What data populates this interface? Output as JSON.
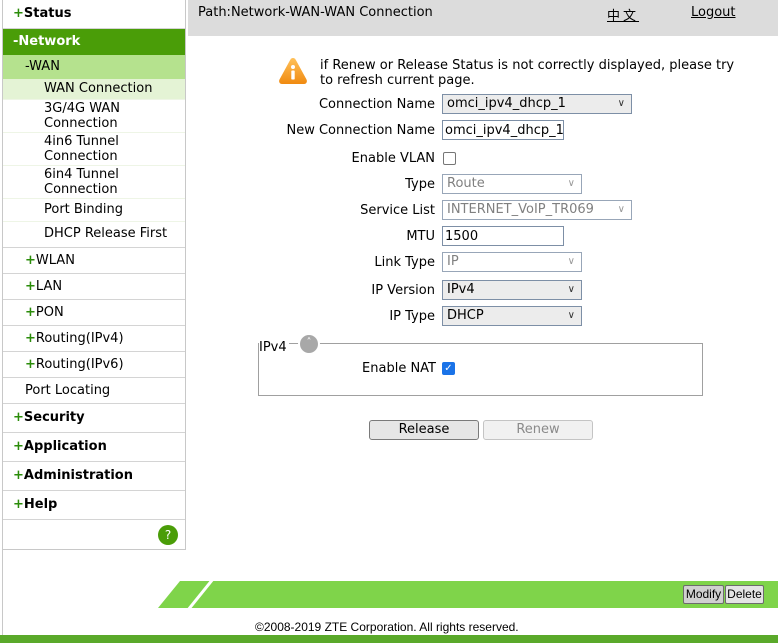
{
  "sidebar": {
    "status": "Status",
    "network": "-Network",
    "wan": "-WAN",
    "wan_items": [
      {
        "label": "WAN Connection"
      },
      {
        "label_line1": "3G/4G WAN",
        "label_line2": "Connection"
      },
      {
        "label_line1": "4in6 Tunnel",
        "label_line2": "Connection"
      },
      {
        "label_line1": "6in4 Tunnel",
        "label_line2": "Connection"
      },
      {
        "label": "Port Binding"
      },
      {
        "label": "DHCP Release First"
      }
    ],
    "network_items": [
      "WLAN",
      "LAN",
      "PON",
      "Routing(IPv4)",
      "Routing(IPv6)"
    ],
    "port_locating": "Port Locating",
    "bottom_items": [
      "Security",
      "Application",
      "Administration",
      "Help"
    ],
    "plus": "+",
    "help_icon": "?"
  },
  "header": {
    "path": "Path:Network-WAN-WAN Connection",
    "language": "中文",
    "logout": "Logout"
  },
  "notice": {
    "icon": "warning-icon",
    "text": "if Renew or Release Status is not correctly displayed, please try to refresh current page."
  },
  "form": {
    "connection_name": {
      "label": "Connection Name",
      "value": "omci_ipv4_dhcp_1"
    },
    "new_connection_name": {
      "label": "New Connection Name",
      "value": "omci_ipv4_dhcp_1"
    },
    "enable_vlan": {
      "label": "Enable VLAN",
      "checked": false
    },
    "type": {
      "label": "Type",
      "value": "Route"
    },
    "service_list": {
      "label": "Service List",
      "value": "INTERNET_VoIP_TR069"
    },
    "mtu": {
      "label": "MTU",
      "value": "1500"
    },
    "link_type": {
      "label": "Link Type",
      "value": "IP"
    },
    "ip_version": {
      "label": "IP Version",
      "value": "IPv4"
    },
    "ip_type": {
      "label": "IP Type",
      "value": "DHCP"
    }
  },
  "ipv4_section": {
    "legend": "IPv4",
    "enable_nat": {
      "label": "Enable NAT",
      "checked": true
    }
  },
  "actions": {
    "release": "Release",
    "renew": "Renew",
    "modify": "Modify",
    "delete": "Delete"
  },
  "footer": {
    "copyright": "©2008-2019 ZTE Corporation. All rights reserved."
  },
  "colors": {
    "brand_green": "#4a9d08",
    "light_green": "#b5e28e",
    "band_green": "#7fd44a",
    "bottom_green": "#5aa92a"
  }
}
